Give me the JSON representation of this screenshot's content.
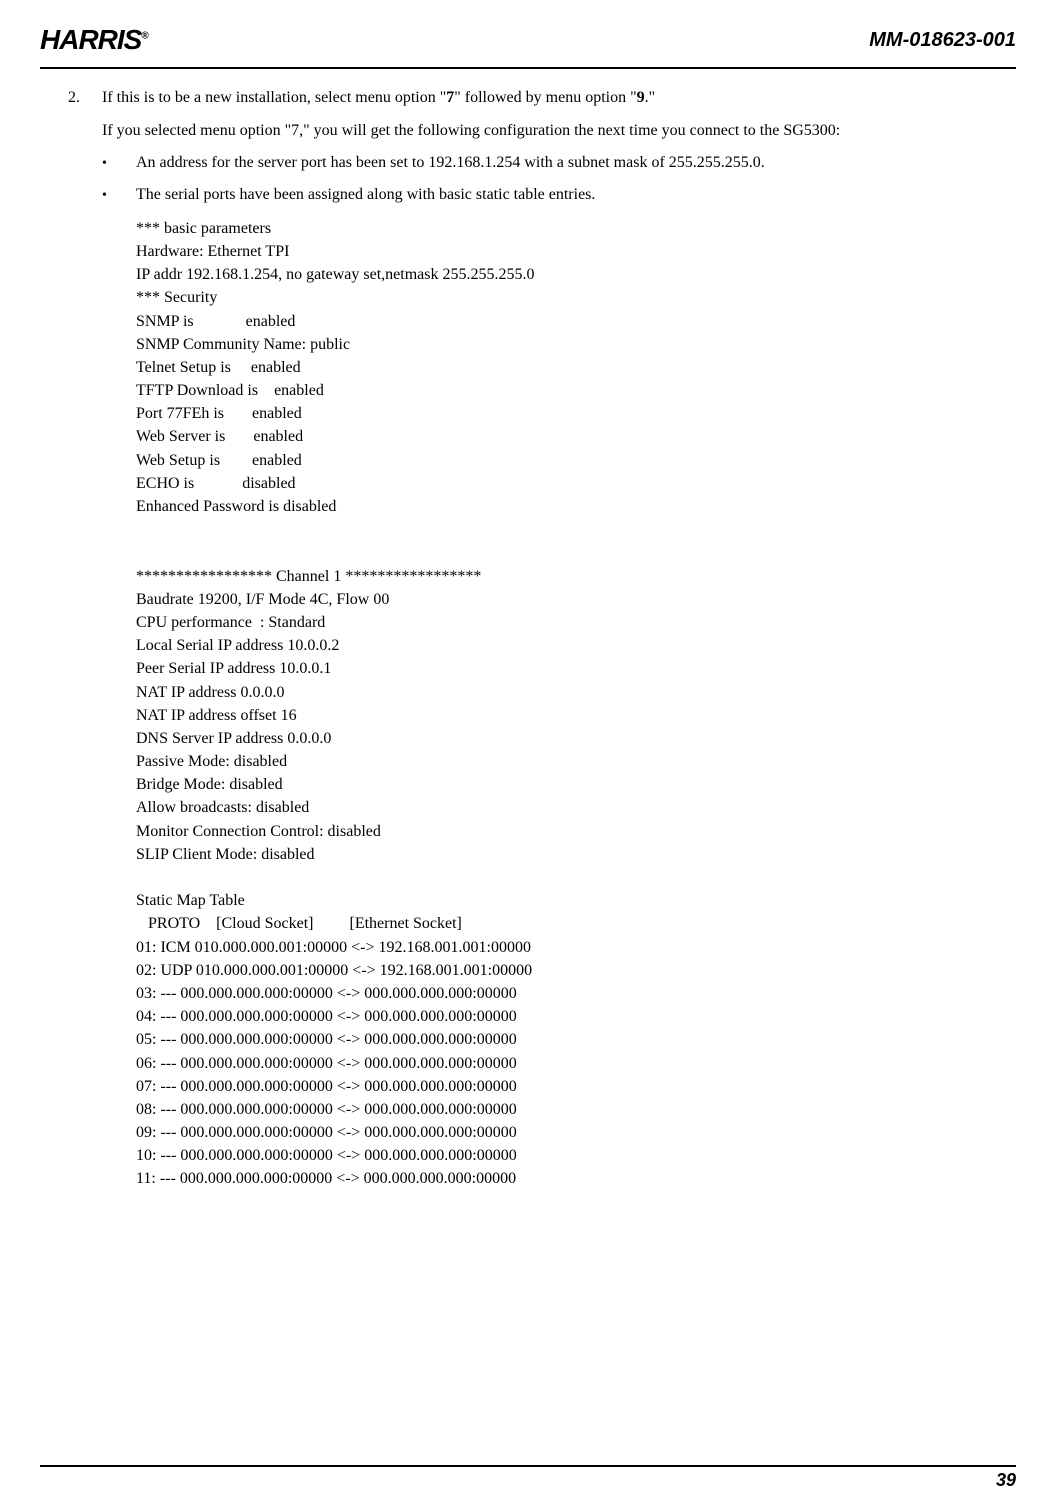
{
  "header": {
    "logo_text": "HARRIS",
    "logo_reg": "®",
    "doc_id": "MM-018623-001"
  },
  "step": {
    "number": "2.",
    "intro_pre": "If this is to be a new installation, select menu option \"",
    "opt7": "7",
    "intro_mid": "\" followed by menu option \"",
    "opt9": "9",
    "intro_post": ".\"",
    "para2": "If you selected menu option \"7,\" you will get the following configuration the next time you connect to the SG5300:"
  },
  "bullets": [
    "An address for the server port has been set to 192.168.1.254 with a subnet mask of 255.255.255.0.",
    "The serial ports have been assigned along with basic static table entries."
  ],
  "config": "*** basic parameters\nHardware: Ethernet TPI\nIP addr 192.168.1.254, no gateway set,netmask 255.255.255.0\n*** Security\nSNMP is             enabled\nSNMP Community Name: public\nTelnet Setup is     enabled\nTFTP Download is    enabled\nPort 77FEh is       enabled\nWeb Server is       enabled\nWeb Setup is        enabled\nECHO is            disabled\nEnhanced Password is disabled\n\n\n***************** Channel 1 *****************\nBaudrate 19200, I/F Mode 4C, Flow 00\nCPU performance  : Standard\nLocal Serial IP address 10.0.0.2\nPeer Serial IP address 10.0.0.1\nNAT IP address 0.0.0.0\nNAT IP address offset 16\nDNS Server IP address 0.0.0.0\nPassive Mode: disabled\nBridge Mode: disabled\nAllow broadcasts: disabled\nMonitor Connection Control: disabled\nSLIP Client Mode: disabled\n\nStatic Map Table\n   PROTO    [Cloud Socket]         [Ethernet Socket]\n01: ICM 010.000.000.001:00000 <-> 192.168.001.001:00000\n02: UDP 010.000.000.001:00000 <-> 192.168.001.001:00000\n03: --- 000.000.000.000:00000 <-> 000.000.000.000:00000\n04: --- 000.000.000.000:00000 <-> 000.000.000.000:00000\n05: --- 000.000.000.000:00000 <-> 000.000.000.000:00000\n06: --- 000.000.000.000:00000 <-> 000.000.000.000:00000\n07: --- 000.000.000.000:00000 <-> 000.000.000.000:00000\n08: --- 000.000.000.000:00000 <-> 000.000.000.000:00000\n09: --- 000.000.000.000:00000 <-> 000.000.000.000:00000\n10: --- 000.000.000.000:00000 <-> 000.000.000.000:00000\n11: --- 000.000.000.000:00000 <-> 000.000.000.000:00000",
  "footer": {
    "page_num": "39"
  }
}
